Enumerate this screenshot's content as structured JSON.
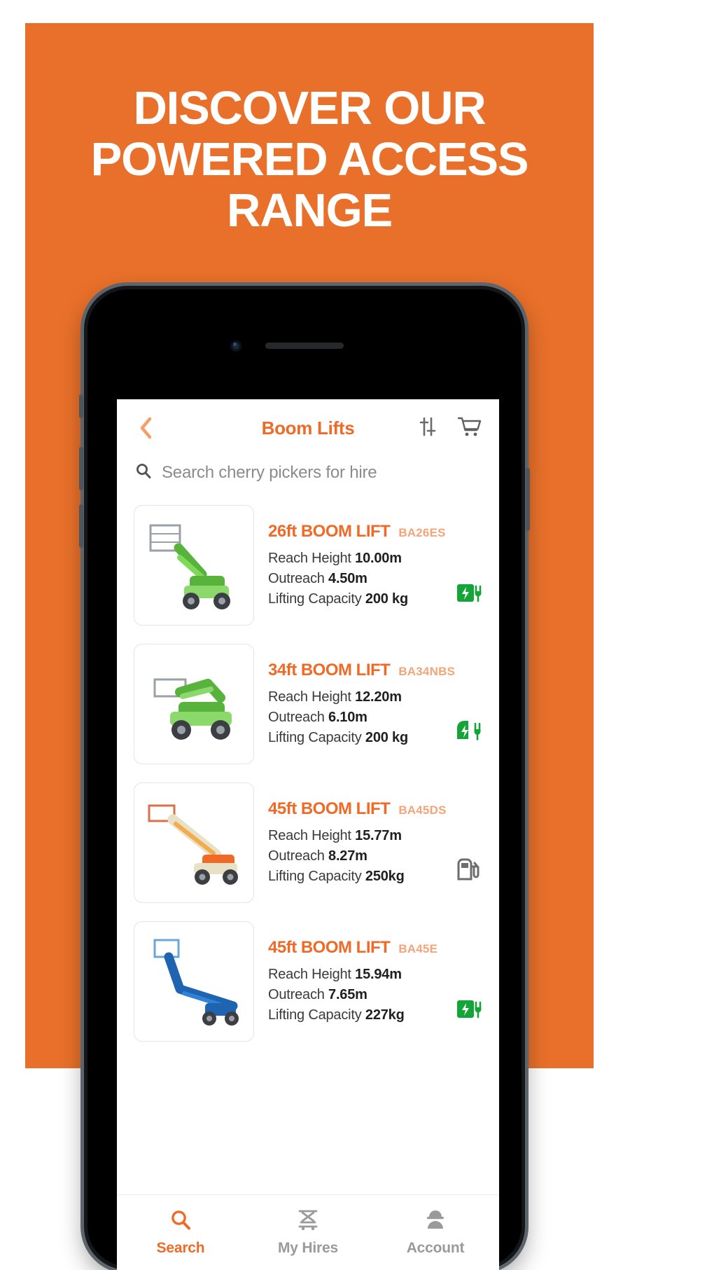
{
  "poster": {
    "background_color": "#e8702a",
    "headline": "DISCOVER OUR POWERED ACCESS RANGE"
  },
  "app": {
    "accent_color": "#ef6a26",
    "header": {
      "back_icon": "chevron-left-icon",
      "title": "Boom Lifts",
      "filter_icon": "sliders-filter-icon",
      "cart_icon": "shopping-cart-icon"
    },
    "search": {
      "icon": "search-icon",
      "placeholder": "Search cherry pickers for hire",
      "value": ""
    },
    "products": [
      {
        "name": "26ft BOOM LIFT",
        "code": "BA26ES",
        "image": "green-boom-lift-thumbnail",
        "reach_label": "Reach Height",
        "reach_value": "10.00m",
        "outreach_label": "Outreach",
        "outreach_value": "4.50m",
        "capacity_label": "Lifting Capacity",
        "capacity_value": "200 kg",
        "power_icon": "electric-battery-plug-icon"
      },
      {
        "name": "34ft BOOM LIFT",
        "code": "BA34NBS",
        "image": "green-boom-lift-thumbnail",
        "reach_label": "Reach Height",
        "reach_value": "12.20m",
        "outreach_label": "Outreach",
        "outreach_value": "6.10m",
        "capacity_label": "Lifting Capacity",
        "capacity_value": "200 kg",
        "power_icon": "electric-plug-icon"
      },
      {
        "name": "45ft BOOM LIFT",
        "code": "BA45DS",
        "image": "orange-boom-lift-thumbnail",
        "reach_label": "Reach Height",
        "reach_value": "15.77m",
        "outreach_label": "Outreach",
        "outreach_value": "8.27m",
        "capacity_label": "Lifting Capacity",
        "capacity_value": "250kg",
        "power_icon": "diesel-fuel-pump-icon"
      },
      {
        "name": "45ft BOOM LIFT",
        "code": "BA45E",
        "image": "blue-boom-lift-thumbnail",
        "reach_label": "Reach Height",
        "reach_value": "15.94m",
        "outreach_label": "Outreach",
        "outreach_value": "7.65m",
        "capacity_label": "Lifting Capacity",
        "capacity_value": "227kg",
        "power_icon": "electric-battery-plug-icon"
      }
    ],
    "tabbar": [
      {
        "label": "Search",
        "icon": "search-icon",
        "active": true
      },
      {
        "label": "My Hires",
        "icon": "scissor-lift-icon",
        "active": false
      },
      {
        "label": "Account",
        "icon": "person-helmet-icon",
        "active": false
      }
    ]
  }
}
